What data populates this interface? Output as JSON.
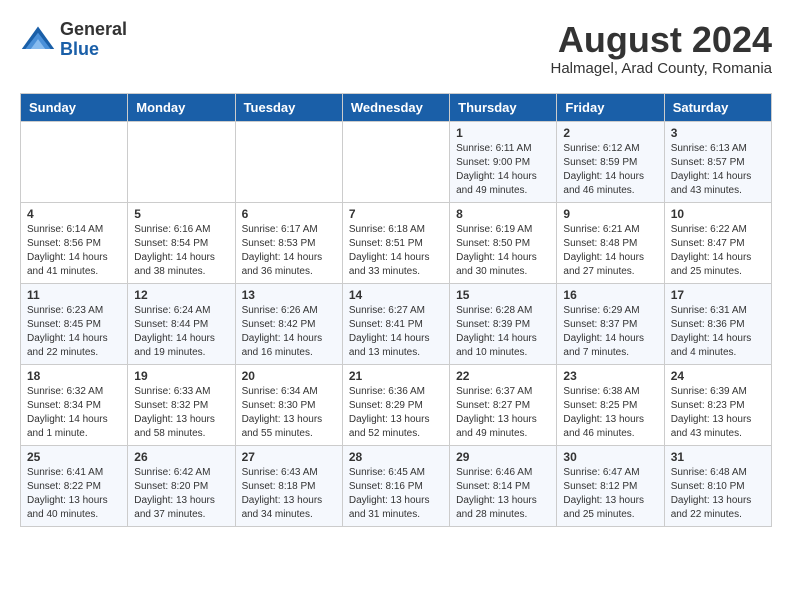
{
  "header": {
    "logo_general": "General",
    "logo_blue": "Blue",
    "month_year": "August 2024",
    "location": "Halmagel, Arad County, Romania"
  },
  "weekdays": [
    "Sunday",
    "Monday",
    "Tuesday",
    "Wednesday",
    "Thursday",
    "Friday",
    "Saturday"
  ],
  "weeks": [
    [
      {
        "day": "",
        "info": ""
      },
      {
        "day": "",
        "info": ""
      },
      {
        "day": "",
        "info": ""
      },
      {
        "day": "",
        "info": ""
      },
      {
        "day": "1",
        "info": "Sunrise: 6:11 AM\nSunset: 9:00 PM\nDaylight: 14 hours\nand 49 minutes."
      },
      {
        "day": "2",
        "info": "Sunrise: 6:12 AM\nSunset: 8:59 PM\nDaylight: 14 hours\nand 46 minutes."
      },
      {
        "day": "3",
        "info": "Sunrise: 6:13 AM\nSunset: 8:57 PM\nDaylight: 14 hours\nand 43 minutes."
      }
    ],
    [
      {
        "day": "4",
        "info": "Sunrise: 6:14 AM\nSunset: 8:56 PM\nDaylight: 14 hours\nand 41 minutes."
      },
      {
        "day": "5",
        "info": "Sunrise: 6:16 AM\nSunset: 8:54 PM\nDaylight: 14 hours\nand 38 minutes."
      },
      {
        "day": "6",
        "info": "Sunrise: 6:17 AM\nSunset: 8:53 PM\nDaylight: 14 hours\nand 36 minutes."
      },
      {
        "day": "7",
        "info": "Sunrise: 6:18 AM\nSunset: 8:51 PM\nDaylight: 14 hours\nand 33 minutes."
      },
      {
        "day": "8",
        "info": "Sunrise: 6:19 AM\nSunset: 8:50 PM\nDaylight: 14 hours\nand 30 minutes."
      },
      {
        "day": "9",
        "info": "Sunrise: 6:21 AM\nSunset: 8:48 PM\nDaylight: 14 hours\nand 27 minutes."
      },
      {
        "day": "10",
        "info": "Sunrise: 6:22 AM\nSunset: 8:47 PM\nDaylight: 14 hours\nand 25 minutes."
      }
    ],
    [
      {
        "day": "11",
        "info": "Sunrise: 6:23 AM\nSunset: 8:45 PM\nDaylight: 14 hours\nand 22 minutes."
      },
      {
        "day": "12",
        "info": "Sunrise: 6:24 AM\nSunset: 8:44 PM\nDaylight: 14 hours\nand 19 minutes."
      },
      {
        "day": "13",
        "info": "Sunrise: 6:26 AM\nSunset: 8:42 PM\nDaylight: 14 hours\nand 16 minutes."
      },
      {
        "day": "14",
        "info": "Sunrise: 6:27 AM\nSunset: 8:41 PM\nDaylight: 14 hours\nand 13 minutes."
      },
      {
        "day": "15",
        "info": "Sunrise: 6:28 AM\nSunset: 8:39 PM\nDaylight: 14 hours\nand 10 minutes."
      },
      {
        "day": "16",
        "info": "Sunrise: 6:29 AM\nSunset: 8:37 PM\nDaylight: 14 hours\nand 7 minutes."
      },
      {
        "day": "17",
        "info": "Sunrise: 6:31 AM\nSunset: 8:36 PM\nDaylight: 14 hours\nand 4 minutes."
      }
    ],
    [
      {
        "day": "18",
        "info": "Sunrise: 6:32 AM\nSunset: 8:34 PM\nDaylight: 14 hours\nand 1 minute."
      },
      {
        "day": "19",
        "info": "Sunrise: 6:33 AM\nSunset: 8:32 PM\nDaylight: 13 hours\nand 58 minutes."
      },
      {
        "day": "20",
        "info": "Sunrise: 6:34 AM\nSunset: 8:30 PM\nDaylight: 13 hours\nand 55 minutes."
      },
      {
        "day": "21",
        "info": "Sunrise: 6:36 AM\nSunset: 8:29 PM\nDaylight: 13 hours\nand 52 minutes."
      },
      {
        "day": "22",
        "info": "Sunrise: 6:37 AM\nSunset: 8:27 PM\nDaylight: 13 hours\nand 49 minutes."
      },
      {
        "day": "23",
        "info": "Sunrise: 6:38 AM\nSunset: 8:25 PM\nDaylight: 13 hours\nand 46 minutes."
      },
      {
        "day": "24",
        "info": "Sunrise: 6:39 AM\nSunset: 8:23 PM\nDaylight: 13 hours\nand 43 minutes."
      }
    ],
    [
      {
        "day": "25",
        "info": "Sunrise: 6:41 AM\nSunset: 8:22 PM\nDaylight: 13 hours\nand 40 minutes."
      },
      {
        "day": "26",
        "info": "Sunrise: 6:42 AM\nSunset: 8:20 PM\nDaylight: 13 hours\nand 37 minutes."
      },
      {
        "day": "27",
        "info": "Sunrise: 6:43 AM\nSunset: 8:18 PM\nDaylight: 13 hours\nand 34 minutes."
      },
      {
        "day": "28",
        "info": "Sunrise: 6:45 AM\nSunset: 8:16 PM\nDaylight: 13 hours\nand 31 minutes."
      },
      {
        "day": "29",
        "info": "Sunrise: 6:46 AM\nSunset: 8:14 PM\nDaylight: 13 hours\nand 28 minutes."
      },
      {
        "day": "30",
        "info": "Sunrise: 6:47 AM\nSunset: 8:12 PM\nDaylight: 13 hours\nand 25 minutes."
      },
      {
        "day": "31",
        "info": "Sunrise: 6:48 AM\nSunset: 8:10 PM\nDaylight: 13 hours\nand 22 minutes."
      }
    ]
  ]
}
